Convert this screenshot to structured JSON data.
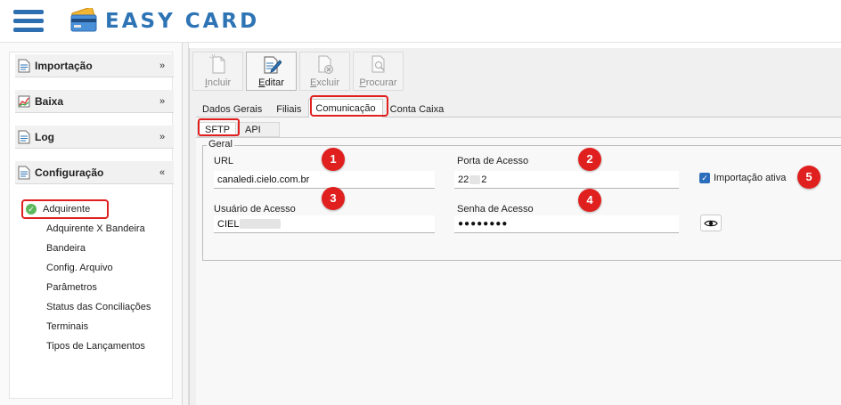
{
  "header": {
    "logo_text": "EASY CARD",
    "menu_icon": "hamburger-menu-icon",
    "brand_color": "#2e74b5"
  },
  "sidebar": {
    "groups": [
      {
        "label": "Importação",
        "icon": "document-icon",
        "state": "collapsed"
      },
      {
        "label": "Baixa",
        "icon": "chart-icon",
        "state": "collapsed"
      },
      {
        "label": "Log",
        "icon": "document-icon",
        "state": "collapsed"
      },
      {
        "label": "Configuração",
        "icon": "document-icon",
        "state": "expanded"
      }
    ],
    "items": [
      {
        "label": "Adquirente",
        "selected": true
      },
      {
        "label": "Adquirente X Bandeira"
      },
      {
        "label": "Bandeira"
      },
      {
        "label": "Config. Arquivo"
      },
      {
        "label": "Parâmetros"
      },
      {
        "label": "Status das Conciliações"
      },
      {
        "label": "Terminais"
      },
      {
        "label": "Tipos de Lançamentos"
      }
    ]
  },
  "toolbar": {
    "buttons": [
      {
        "label": "Incluir",
        "underline": "I",
        "rest": "ncluir",
        "enabled": false,
        "icon": "new-document-icon"
      },
      {
        "label": "Editar",
        "underline": "E",
        "rest": "ditar",
        "enabled": true,
        "icon": "edit-icon"
      },
      {
        "label": "Excluir",
        "underline": "E",
        "rest": "xcluir",
        "enabled": false,
        "icon": "delete-document-icon"
      },
      {
        "label": "Procurar",
        "underline": "P",
        "rest": "rocurar",
        "enabled": false,
        "icon": "search-document-icon"
      }
    ]
  },
  "tabs": {
    "main": [
      "Dados Gerais",
      "Filiais",
      "Comunicação",
      "Conta Caixa"
    ],
    "main_active": "Comunicação",
    "sub": [
      "SFTP",
      "API"
    ],
    "sub_active": "SFTP"
  },
  "form": {
    "group_title": "Geral",
    "url_label": "URL",
    "url_value": "canaledi.cielo.com.br",
    "porta_label": "Porta de Acesso",
    "porta_value_start": "22",
    "porta_value_end": "2",
    "usuario_label": "Usuário de Acesso",
    "usuario_value": "CIEL",
    "senha_label": "Senha de Acesso",
    "senha_value": "●●●●●●●●",
    "importacao_label": "Importação ativa",
    "importacao_checked": true,
    "show_password_icon": "eye-icon"
  },
  "annotations": [
    "1",
    "2",
    "3",
    "4",
    "5"
  ],
  "colors": {
    "highlight_red": "#e0201f",
    "checkbox_blue": "#2a6ebb",
    "success_green": "#5cb85c"
  }
}
